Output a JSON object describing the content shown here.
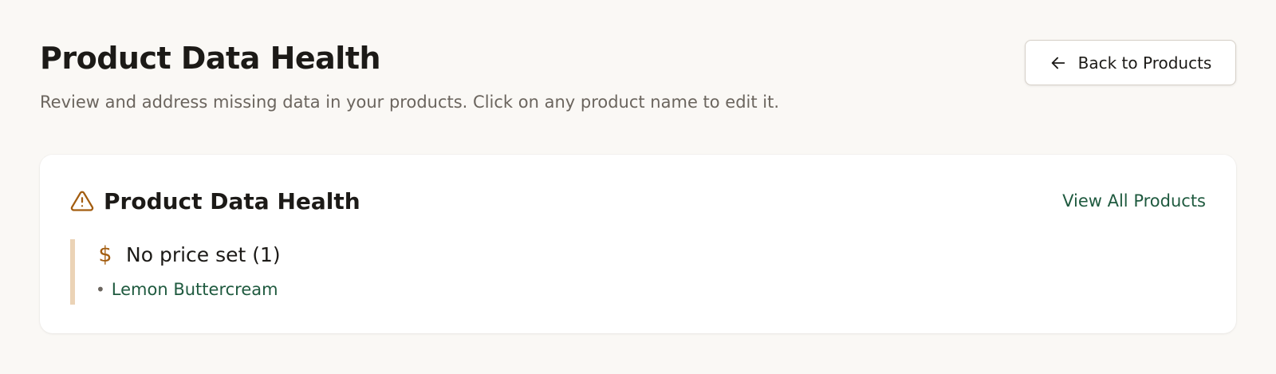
{
  "header": {
    "title": "Product Data Health",
    "subtitle": "Review and address missing data in your products. Click on any product name to edit it.",
    "back_button_label": "Back to Products",
    "back_button_icon": "arrow-left-icon"
  },
  "card": {
    "icon": "warning-triangle-icon",
    "title": "Product Data Health",
    "view_all_label": "View All Products",
    "issues": [
      {
        "icon": "dollar-sign-icon",
        "icon_glyph": "$",
        "title": "No price set (1)",
        "items": [
          {
            "bullet": "•",
            "label": "Lemon Buttercream"
          }
        ]
      }
    ]
  },
  "colors": {
    "background": "#faf8f5",
    "card_background": "#ffffff",
    "accent_link": "#1f5a3f",
    "warning_icon": "#a35d10",
    "issue_border": "#ebd3b6",
    "text_primary": "#1c1a17",
    "text_muted": "#6b655e"
  }
}
